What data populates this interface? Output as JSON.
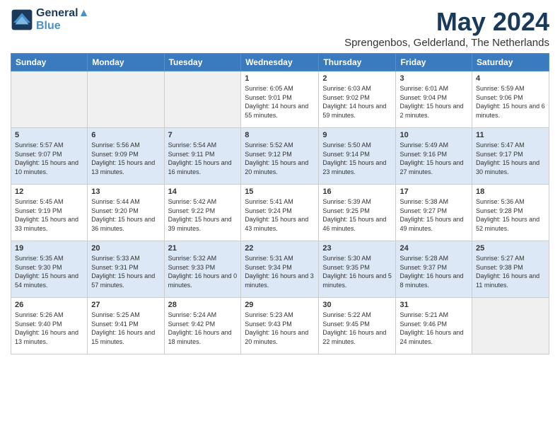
{
  "header": {
    "logo_line1": "General",
    "logo_line2": "Blue",
    "title": "May 2024",
    "location": "Sprengenbos, Gelderland, The Netherlands"
  },
  "weekdays": [
    "Sunday",
    "Monday",
    "Tuesday",
    "Wednesday",
    "Thursday",
    "Friday",
    "Saturday"
  ],
  "weeks": [
    [
      {
        "day": "",
        "empty": true
      },
      {
        "day": "",
        "empty": true
      },
      {
        "day": "",
        "empty": true
      },
      {
        "day": "1",
        "sunrise": "6:05 AM",
        "sunset": "9:01 PM",
        "daylight": "14 hours and 55 minutes."
      },
      {
        "day": "2",
        "sunrise": "6:03 AM",
        "sunset": "9:02 PM",
        "daylight": "14 hours and 59 minutes."
      },
      {
        "day": "3",
        "sunrise": "6:01 AM",
        "sunset": "9:04 PM",
        "daylight": "15 hours and 2 minutes."
      },
      {
        "day": "4",
        "sunrise": "5:59 AM",
        "sunset": "9:06 PM",
        "daylight": "15 hours and 6 minutes."
      }
    ],
    [
      {
        "day": "5",
        "sunrise": "5:57 AM",
        "sunset": "9:07 PM",
        "daylight": "15 hours and 10 minutes."
      },
      {
        "day": "6",
        "sunrise": "5:56 AM",
        "sunset": "9:09 PM",
        "daylight": "15 hours and 13 minutes."
      },
      {
        "day": "7",
        "sunrise": "5:54 AM",
        "sunset": "9:11 PM",
        "daylight": "15 hours and 16 minutes."
      },
      {
        "day": "8",
        "sunrise": "5:52 AM",
        "sunset": "9:12 PM",
        "daylight": "15 hours and 20 minutes."
      },
      {
        "day": "9",
        "sunrise": "5:50 AM",
        "sunset": "9:14 PM",
        "daylight": "15 hours and 23 minutes."
      },
      {
        "day": "10",
        "sunrise": "5:49 AM",
        "sunset": "9:16 PM",
        "daylight": "15 hours and 27 minutes."
      },
      {
        "day": "11",
        "sunrise": "5:47 AM",
        "sunset": "9:17 PM",
        "daylight": "15 hours and 30 minutes."
      }
    ],
    [
      {
        "day": "12",
        "sunrise": "5:45 AM",
        "sunset": "9:19 PM",
        "daylight": "15 hours and 33 minutes."
      },
      {
        "day": "13",
        "sunrise": "5:44 AM",
        "sunset": "9:20 PM",
        "daylight": "15 hours and 36 minutes."
      },
      {
        "day": "14",
        "sunrise": "5:42 AM",
        "sunset": "9:22 PM",
        "daylight": "15 hours and 39 minutes."
      },
      {
        "day": "15",
        "sunrise": "5:41 AM",
        "sunset": "9:24 PM",
        "daylight": "15 hours and 43 minutes."
      },
      {
        "day": "16",
        "sunrise": "5:39 AM",
        "sunset": "9:25 PM",
        "daylight": "15 hours and 46 minutes."
      },
      {
        "day": "17",
        "sunrise": "5:38 AM",
        "sunset": "9:27 PM",
        "daylight": "15 hours and 49 minutes."
      },
      {
        "day": "18",
        "sunrise": "5:36 AM",
        "sunset": "9:28 PM",
        "daylight": "15 hours and 52 minutes."
      }
    ],
    [
      {
        "day": "19",
        "sunrise": "5:35 AM",
        "sunset": "9:30 PM",
        "daylight": "15 hours and 54 minutes."
      },
      {
        "day": "20",
        "sunrise": "5:33 AM",
        "sunset": "9:31 PM",
        "daylight": "15 hours and 57 minutes."
      },
      {
        "day": "21",
        "sunrise": "5:32 AM",
        "sunset": "9:33 PM",
        "daylight": "16 hours and 0 minutes."
      },
      {
        "day": "22",
        "sunrise": "5:31 AM",
        "sunset": "9:34 PM",
        "daylight": "16 hours and 3 minutes."
      },
      {
        "day": "23",
        "sunrise": "5:30 AM",
        "sunset": "9:35 PM",
        "daylight": "16 hours and 5 minutes."
      },
      {
        "day": "24",
        "sunrise": "5:28 AM",
        "sunset": "9:37 PM",
        "daylight": "16 hours and 8 minutes."
      },
      {
        "day": "25",
        "sunrise": "5:27 AM",
        "sunset": "9:38 PM",
        "daylight": "16 hours and 11 minutes."
      }
    ],
    [
      {
        "day": "26",
        "sunrise": "5:26 AM",
        "sunset": "9:40 PM",
        "daylight": "16 hours and 13 minutes."
      },
      {
        "day": "27",
        "sunrise": "5:25 AM",
        "sunset": "9:41 PM",
        "daylight": "16 hours and 15 minutes."
      },
      {
        "day": "28",
        "sunrise": "5:24 AM",
        "sunset": "9:42 PM",
        "daylight": "16 hours and 18 minutes."
      },
      {
        "day": "29",
        "sunrise": "5:23 AM",
        "sunset": "9:43 PM",
        "daylight": "16 hours and 20 minutes."
      },
      {
        "day": "30",
        "sunrise": "5:22 AM",
        "sunset": "9:45 PM",
        "daylight": "16 hours and 22 minutes."
      },
      {
        "day": "31",
        "sunrise": "5:21 AM",
        "sunset": "9:46 PM",
        "daylight": "16 hours and 24 minutes."
      },
      {
        "day": "",
        "empty": true
      }
    ]
  ]
}
